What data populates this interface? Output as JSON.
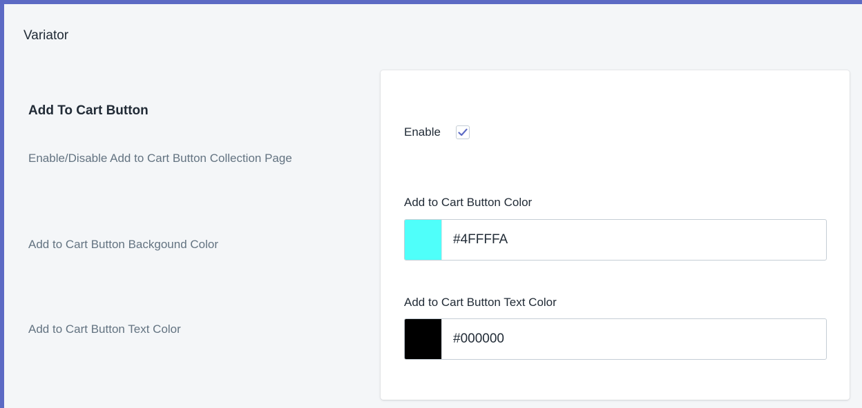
{
  "app": {
    "title": "Variator"
  },
  "section": {
    "heading": "Add To Cart Button",
    "descriptions": [
      "Enable/Disable Add to Cart Button Collection Page",
      "Add to Cart Button Backgound Color",
      "Add to Cart Button Text Color"
    ]
  },
  "settings": {
    "enable_label": "Enable",
    "enable_checked": true,
    "background_color": {
      "label": "Add to Cart Button Color",
      "value": "#4FFFFA",
      "swatch": "#4FFFFA"
    },
    "text_color": {
      "label": "Add to Cart Button Text Color",
      "value": "#000000",
      "swatch": "#000000"
    }
  },
  "theme": {
    "accent": "#5c6ac4",
    "checkmark": "#5c6ac4"
  }
}
